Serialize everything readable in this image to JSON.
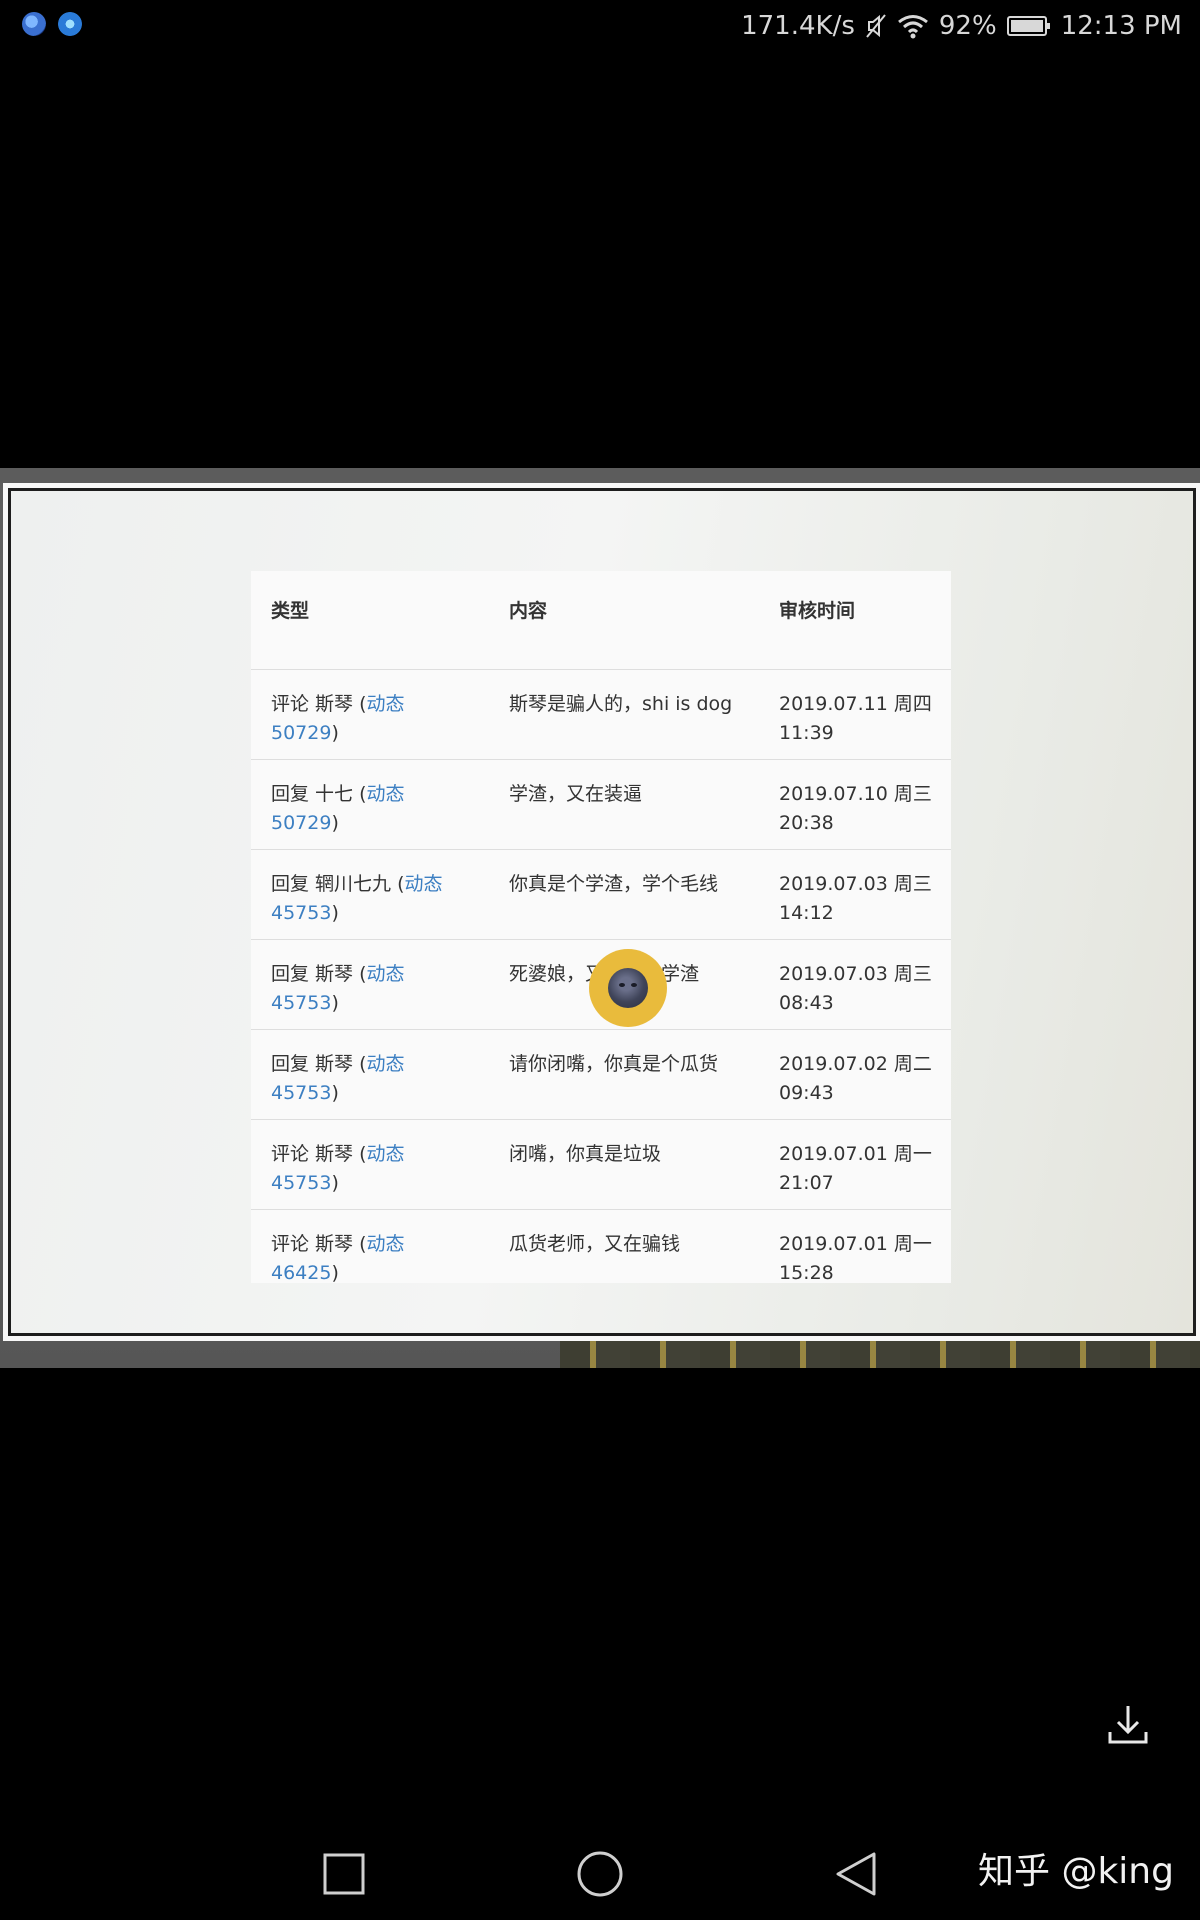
{
  "status_bar": {
    "net_speed": "171.4K/s",
    "battery": "92%",
    "time": "12:13 PM",
    "icons": [
      "app-icon",
      "app-icon",
      "mute-icon",
      "wifi-icon",
      "battery-icon"
    ]
  },
  "table": {
    "headers": {
      "type": "类型",
      "content": "内容",
      "time": "审核时间"
    },
    "rows": [
      {
        "type_prefix": "评论 斯琴 (",
        "type_link": "动态 50729",
        "type_suffix": ")",
        "content": "斯琴是骗人的，shi is dog",
        "date": "2019.07.11 周四",
        "clock": "11:39"
      },
      {
        "type_prefix": "回复 十七 (",
        "type_link": "动态 50729",
        "type_suffix": ")",
        "content": "学渣，又在装逼",
        "date": "2019.07.10 周三",
        "clock": "20:38"
      },
      {
        "type_prefix": "回复 辋川七九 (",
        "type_link": "动态 45753",
        "type_suffix": ")",
        "content": "你真是个学渣，学个毛线",
        "date": "2019.07.03 周三",
        "clock": "14:12"
      },
      {
        "type_prefix": "回复 斯琴 (",
        "type_link": "动态 45753",
        "type_suffix": ")",
        "content": "死婆娘，又在勾引学渣",
        "date": "2019.07.03 周三",
        "clock": "08:43"
      },
      {
        "type_prefix": "回复 斯琴 (",
        "type_link": "动态 45753",
        "type_suffix": ")",
        "content": "请你闭嘴，你真是个瓜货",
        "date": "2019.07.02 周二",
        "clock": "09:43"
      },
      {
        "type_prefix": "评论 斯琴 (",
        "type_link": "动态 45753",
        "type_suffix": ")",
        "content": "闭嘴，你真是垃圾",
        "date": "2019.07.01 周一",
        "clock": "21:07"
      },
      {
        "type_prefix": "评论 斯琴 (",
        "type_link": "动态 46425",
        "type_suffix": ")",
        "content": "瓜货老师，又在骗钱",
        "date": "2019.07.01 周一",
        "clock": "15:28"
      }
    ]
  },
  "overlay": {
    "emoji_icon": "moon-face-icon"
  },
  "watermark": "知乎 @king",
  "nav": {
    "icons": [
      "recents-square-icon",
      "home-circle-icon",
      "back-triangle-icon"
    ]
  },
  "colors": {
    "link": "#3c7fc2",
    "emoji_bg": "#e9bb3c"
  }
}
